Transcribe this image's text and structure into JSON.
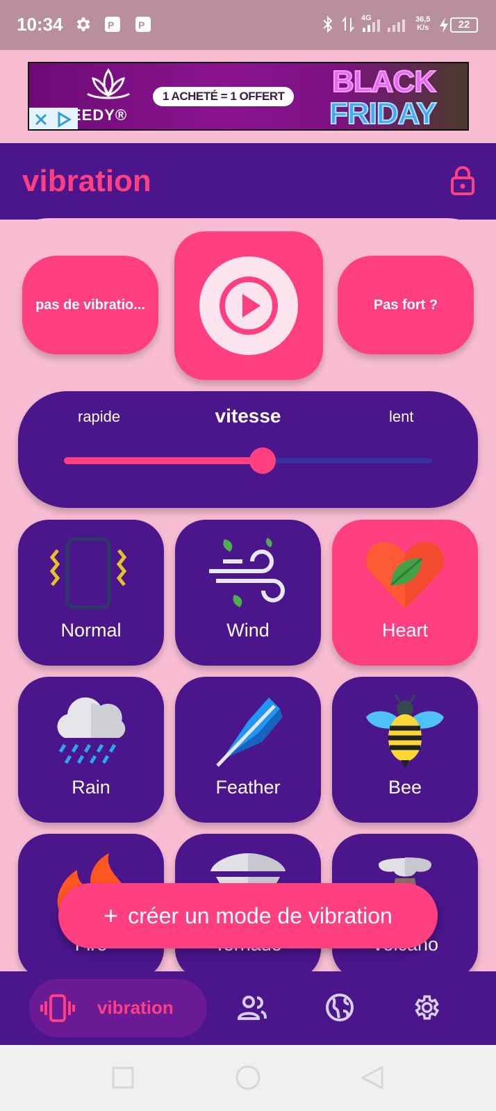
{
  "status_bar": {
    "time": "10:34",
    "network": "4G",
    "speed_value": "36,5",
    "speed_unit": "K/s",
    "battery": "22"
  },
  "ad": {
    "offer": "1 ACHETÉ = 1 OFFERT",
    "brand": "EEDY®",
    "headline_top": "BLACK",
    "headline_bottom": "FRIDAY"
  },
  "header": {
    "title": "vibration",
    "lock_icon": "lock-icon"
  },
  "controls": {
    "left_button": "pas de vibratio...",
    "right_button": "Pas fort ?",
    "play_icon": "play-icon"
  },
  "speed": {
    "title": "vitesse",
    "left_label": "rapide",
    "right_label": "lent",
    "value_fraction": 0.54
  },
  "modes": [
    {
      "label": "Normal",
      "icon": "phone-vibrate-icon",
      "active": false
    },
    {
      "label": "Wind",
      "icon": "wind-icon",
      "active": false
    },
    {
      "label": "Heart",
      "icon": "heart-icon",
      "active": true
    },
    {
      "label": "Rain",
      "icon": "rain-cloud-icon",
      "active": false
    },
    {
      "label": "Feather",
      "icon": "feather-icon",
      "active": false
    },
    {
      "label": "Bee",
      "icon": "bee-icon",
      "active": false
    },
    {
      "label": "Fire",
      "icon": "fire-icon",
      "active": false
    },
    {
      "label": "Tornado",
      "icon": "tornado-icon",
      "active": false
    },
    {
      "label": "Volcano",
      "icon": "volcano-icon",
      "active": false
    }
  ],
  "fab": {
    "plus": "+",
    "label": "créer un mode de vibration"
  },
  "bottom_nav": {
    "active_label": "vibration",
    "items": [
      "vibration-icon",
      "people-icon",
      "globe-icon",
      "settings-icon"
    ]
  },
  "colors": {
    "accent": "#ff3f7f",
    "primary": "#4b168c",
    "background": "#f9bdd3"
  }
}
